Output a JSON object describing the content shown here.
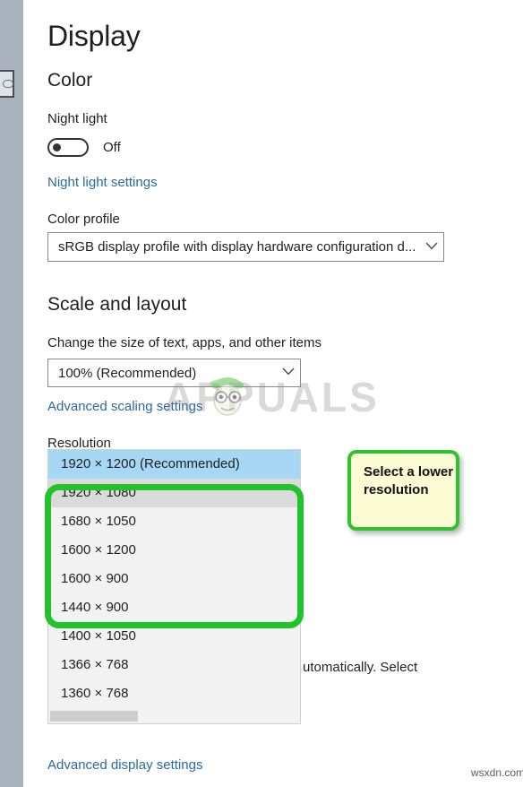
{
  "window": {
    "page_title": "Display"
  },
  "left_rail": {
    "button_icon": "pill-outline-icon"
  },
  "color_section": {
    "heading": "Color",
    "night_light_label": "Night light",
    "night_light_toggle_state": "Off",
    "night_light_toggle_on": false,
    "night_light_settings_link": "Night light settings",
    "color_profile_label": "Color profile",
    "color_profile_value": "sRGB display profile with display hardware configuration d...",
    "chevron_icon": "chevron-down-icon"
  },
  "scale_section": {
    "heading": "Scale and layout",
    "change_size_label": "Change the size of text, apps, and other items",
    "scale_value": "100% (Recommended)",
    "advanced_scaling_link": "Advanced scaling settings",
    "chevron_icon": "chevron-down-icon"
  },
  "resolution_section": {
    "label": "Resolution",
    "options": [
      {
        "label": "1920 × 1200 (Recommended)",
        "state": "selected"
      },
      {
        "label": "1920 × 1080",
        "state": "hovered"
      },
      {
        "label": "1680 × 1050",
        "state": "normal"
      },
      {
        "label": "1600 × 1200",
        "state": "normal"
      },
      {
        "label": "1600 × 900",
        "state": "normal"
      },
      {
        "label": "1440 × 900",
        "state": "normal"
      },
      {
        "label": "1400 × 1050",
        "state": "normal"
      },
      {
        "label": "1366 × 768",
        "state": "normal"
      },
      {
        "label": "1360 × 768",
        "state": "normal"
      }
    ],
    "occluded_body_text": "utomatically. Select"
  },
  "annotations": {
    "callout_text": "Select a lower resolution",
    "callout_fill": "#fbfbd4",
    "callout_border": "#2ec42e",
    "highlight_border": "#22c32a"
  },
  "footer": {
    "advanced_display_link": "Advanced display settings"
  },
  "watermarks": {
    "brand": "APPUALS",
    "site": "wsxdn.com"
  }
}
